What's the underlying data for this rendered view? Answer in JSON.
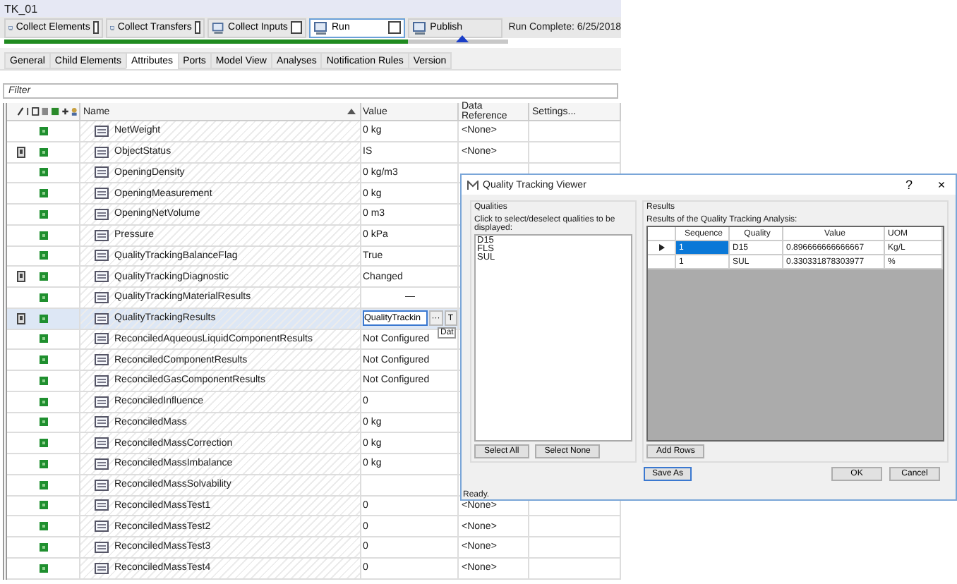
{
  "window": {
    "title": "TK_01"
  },
  "toolbar": {
    "buttons": [
      {
        "label": "Collect Elements",
        "checked": false,
        "selected": false
      },
      {
        "label": "Collect Transfers",
        "checked": false,
        "selected": false
      },
      {
        "label": "Collect Inputs",
        "checked": false,
        "selected": false
      },
      {
        "label": "Run",
        "checked": false,
        "selected": true
      },
      {
        "label": "Publish",
        "selected": false
      }
    ],
    "progress": {
      "level": 0.8
    },
    "status": "Run Complete: 6/25/2018"
  },
  "tabs": [
    {
      "label": "General",
      "selected": false
    },
    {
      "label": "Child Elements",
      "selected": false
    },
    {
      "label": "Attributes",
      "selected": true
    },
    {
      "label": "Ports",
      "selected": false
    },
    {
      "label": "Model View",
      "selected": false
    },
    {
      "label": "Analyses",
      "selected": false
    },
    {
      "label": "Notification Rules",
      "selected": false
    },
    {
      "label": "Version",
      "selected": false
    }
  ],
  "filter": {
    "placeholder": "Filter"
  },
  "table": {
    "columns": [
      "Name",
      "Value",
      "Data Reference",
      "Settings..."
    ],
    "rows": [
      {
        "name": "NetWeight",
        "value": "0 kg",
        "data_reference": "<None>",
        "flag": false,
        "selected": false
      },
      {
        "name": "ObjectStatus",
        "value": "IS",
        "data_reference": "<None>",
        "flag": true,
        "selected": false
      },
      {
        "name": "OpeningDensity",
        "value": "0 kg/m3",
        "flag": false,
        "selected": false
      },
      {
        "name": "OpeningMeasurement",
        "value": "0 kg",
        "flag": false,
        "selected": false
      },
      {
        "name": "OpeningNetVolume",
        "value": "0 m3",
        "flag": false,
        "selected": false
      },
      {
        "name": "Pressure",
        "value": "0 kPa",
        "flag": false,
        "selected": false
      },
      {
        "name": "QualityTrackingBalanceFlag",
        "value": "True",
        "flag": false,
        "selected": false
      },
      {
        "name": "QualityTrackingDiagnostic",
        "value": "Changed",
        "flag": true,
        "selected": false
      },
      {
        "name": "QualityTrackingMaterialResults",
        "value": "—",
        "flag": false,
        "selected": false,
        "kind": "center"
      },
      {
        "name": "QualityTrackingResults",
        "value": "QualityTrackin",
        "flag": true,
        "selected": true,
        "kind": "editor",
        "editor_buttons": [
          "···",
          "T"
        ],
        "tooltip": "Dat"
      },
      {
        "name": "ReconciledAqueousLiquidComponentResults",
        "value": "Not Configured",
        "flag": false,
        "selected": false
      },
      {
        "name": "ReconciledComponentResults",
        "value": "Not Configured",
        "flag": false,
        "selected": false
      },
      {
        "name": "ReconciledGasComponentResults",
        "value": "Not Configured",
        "flag": false,
        "selected": false
      },
      {
        "name": "ReconciledInfluence",
        "value": "0",
        "flag": false,
        "selected": false
      },
      {
        "name": "ReconciledMass",
        "value": "0 kg",
        "flag": false,
        "selected": false
      },
      {
        "name": "ReconciledMassCorrection",
        "value": "0 kg",
        "flag": false,
        "selected": false
      },
      {
        "name": "ReconciledMassImbalance",
        "value": "0 kg",
        "flag": false,
        "selected": false
      },
      {
        "name": "ReconciledMassSolvability",
        "flag": false,
        "selected": false
      },
      {
        "name": "ReconciledMassTest1",
        "value": "0",
        "data_reference": "<None>",
        "flag": false,
        "selected": false
      },
      {
        "name": "ReconciledMassTest2",
        "value": "0",
        "data_reference": "<None>",
        "flag": false,
        "selected": false
      },
      {
        "name": "ReconciledMassTest3",
        "value": "0",
        "data_reference": "<None>",
        "flag": false,
        "selected": false
      },
      {
        "name": "ReconciledMassTest4",
        "value": "0",
        "data_reference": "<None>",
        "flag": false,
        "selected": false
      }
    ]
  },
  "dialog": {
    "title": "Quality Tracking Viewer",
    "help": "?",
    "close": "×",
    "qualities": {
      "label": "Qualities",
      "hint": "Click to select/deselect qualities to be displayed:",
      "items": [
        "D15",
        "FLS",
        "SUL"
      ],
      "buttons": [
        "Select All",
        "Select None"
      ]
    },
    "results": {
      "label": "Results",
      "hint": "Results of the Quality Tracking Analysis:",
      "columns": [
        "Sequence",
        "Quality",
        "Value",
        "UOM"
      ],
      "rows": [
        {
          "current": true,
          "sequence": "1",
          "quality": "D15",
          "value": "0.896666666666667",
          "uom": "Kg/L"
        },
        {
          "current": false,
          "sequence": "1",
          "quality": "SUL",
          "value": "0.330331878303977",
          "uom": "%"
        }
      ],
      "buttons": [
        "Add Rows"
      ]
    },
    "footer_buttons": [
      "Save As",
      "OK",
      "Cancel"
    ],
    "status": "Ready."
  }
}
